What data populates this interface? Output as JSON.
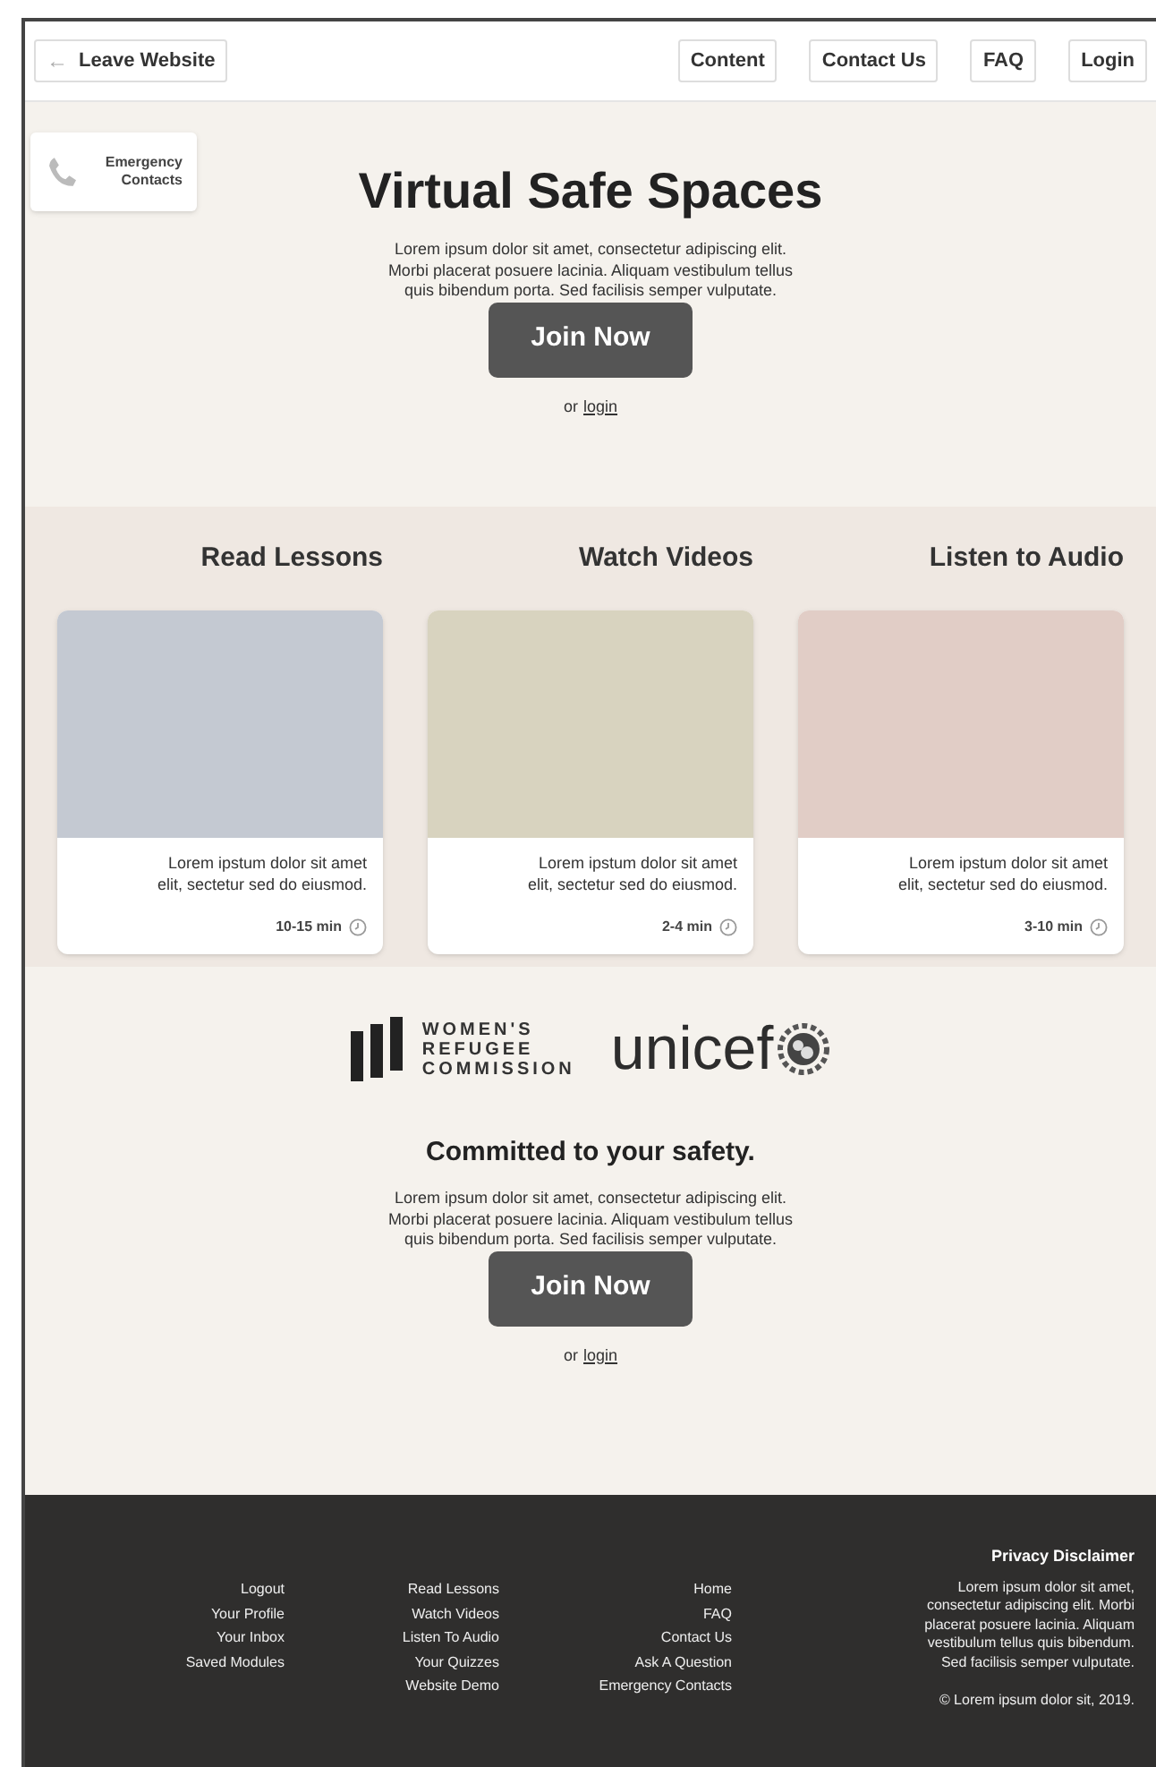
{
  "header": {
    "leave": {
      "icon": "←",
      "label": "Leave Website"
    },
    "nav": [
      "Content",
      "Contact Us",
      "FAQ",
      "Login"
    ]
  },
  "hero": {
    "emergency": {
      "lines": [
        "Emergency",
        "Contacts"
      ]
    },
    "title": "Virtual Safe Spaces",
    "body": [
      "Lorem ipsum dolor sit amet, consectetur adipiscing elit.",
      "Morbi placerat posuere lacinia. Aliquam vestibulum tellus",
      "quis bibendum porta. Sed facilisis semper vulputate."
    ],
    "button": "Join Now",
    "or": "or",
    "link": "login"
  },
  "categories": [
    {
      "title": "Read Lessons",
      "color": "#c4c9d2",
      "text": [
        "Lorem ipstum dolor sit amet",
        "elit, sectetur sed do eiusmod."
      ],
      "time": "10-15 min"
    },
    {
      "title": "Watch Videos",
      "color": "#d8d3bf",
      "text": [
        "Lorem ipstum dolor sit amet",
        "elit, sectetur sed do eiusmod."
      ],
      "time": "2-4 min"
    },
    {
      "title": "Listen to Audio",
      "color": "#e1cdc6",
      "text": [
        "Lorem ipstum dolor sit amet",
        "elit, sectetur sed do eiusmod."
      ],
      "time": "3-10 min"
    }
  ],
  "partners": {
    "wrc": [
      "WOMEN'S",
      "REFUGEE",
      "COMMISSION"
    ],
    "unicef": "unicef",
    "title": "Committed to your safety.",
    "body": [
      "Lorem ipsum dolor sit amet, consectetur adipiscing elit.",
      "Morbi placerat posuere lacinia. Aliquam vestibulum tellus",
      "quis bibendum porta. Sed facilisis semper vulputate."
    ],
    "button": "Join Now",
    "or": "or",
    "link": "login"
  },
  "footer": {
    "columns": [
      [
        "Logout",
        "Your Profile",
        "Your Inbox",
        "Saved Modules"
      ],
      [
        "Read Lessons",
        "Watch Videos",
        "Listen To Audio",
        "Your Quizzes",
        "Website Demo"
      ],
      [
        "Home",
        "FAQ",
        "Contact Us",
        "Ask A Question",
        "Emergency Contacts"
      ]
    ],
    "privacy": {
      "title": "Privacy Disclaimer",
      "body": [
        "Lorem ipsum dolor sit amet,",
        "consectetur adipiscing elit. Morbi",
        "placerat posuere lacinia. Aliquam",
        "vestibulum tellus quis bibendum.",
        "Sed facilisis semper vulputate."
      ],
      "copyright": "© Lorem ipsum dolor sit, 2019."
    }
  }
}
